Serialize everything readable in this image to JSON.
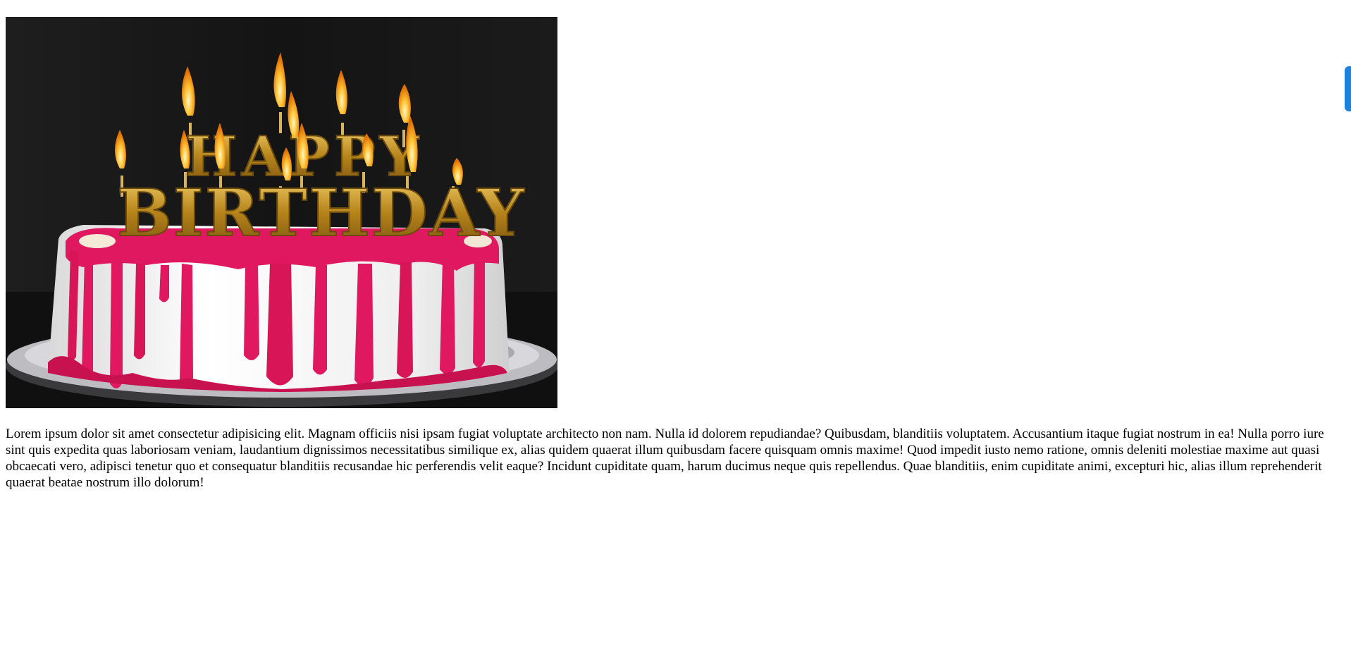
{
  "image": {
    "alt": "HAPPY BIRTHDAY",
    "candle_letters_top": "HAPPY",
    "candle_letters_bottom": "BIRTHDAY",
    "colors": {
      "background": "#141414",
      "frosting": "#f2f2f2",
      "glaze": "#e0185f",
      "gold": "#c9961f",
      "flame": "#ffb21a",
      "plate": "#c9c9cc"
    }
  },
  "paragraph": {
    "text": "Lorem ipsum dolor sit amet consectetur adipisicing elit. Magnam officiis nisi ipsam fugiat voluptate architecto non nam. Nulla id dolorem repudiandae? Quibusdam, blanditiis voluptatem. Accusantium itaque fugiat nostrum in ea! Nulla porro iure sint quis expedita quas laboriosam veniam, laudantium dignissimos necessitatibus similique ex, alias quidem quaerat illum quibusdam facere quisquam omnis maxime! Quod impedit iusto nemo ratione, omnis deleniti molestiae maxime aut quasi obcaecati vero, adipisci tenetur quo et consequatur blanditiis recusandae hic perferendis velit eaque? Incidunt cupiditate quam, harum ducimus neque quis repellendus. Quae blanditiis, enim cupiditate animi, excepturi hic, alias illum reprehenderit quaerat beatae nostrum illo dolorum!"
  },
  "side_tab": {
    "color": "#1a82e2"
  }
}
